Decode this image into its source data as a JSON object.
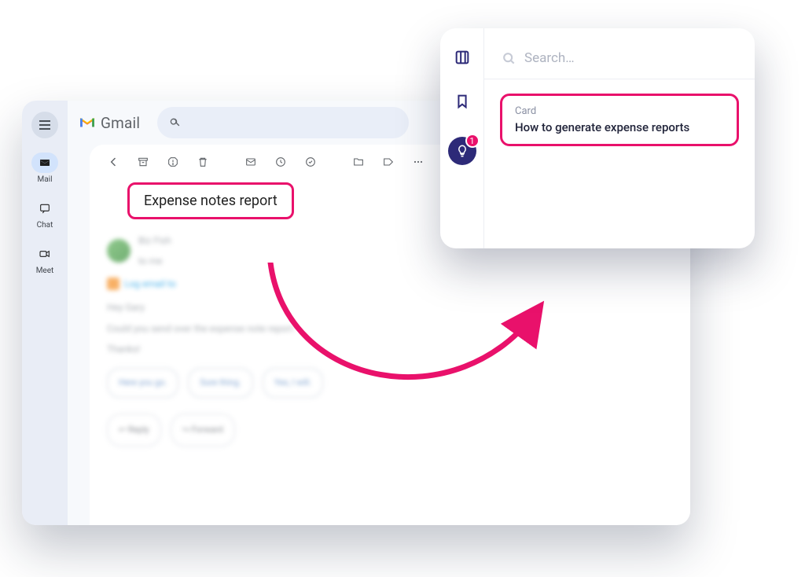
{
  "gmail": {
    "app_name": "Gmail",
    "rail": {
      "mail_label": "Mail",
      "chat_label": "Chat",
      "meet_label": "Meet"
    },
    "toolbar": {
      "back_name": "back-icon",
      "archive_name": "archive-icon",
      "spam_name": "report-spam-icon",
      "delete_name": "delete-icon",
      "unread_name": "mark-unread-icon",
      "snooze_name": "snooze-icon",
      "addtask_name": "add-task-icon",
      "move_name": "move-to-icon",
      "label_name": "labels-icon",
      "more_name": "more-icon"
    },
    "subject": "Expense notes report",
    "blurred": {
      "sender_name": "Biz Fish",
      "to_line": "to me",
      "log_text": "Log email to",
      "body_line1": "Hey Gary",
      "body_line2": "Could you send over the expense note report",
      "body_line3": "Thanks!",
      "smartreply1": "Here you go.",
      "smartreply2": "Sure thing.",
      "smartreply3": "Yes, I will.",
      "reply_label": "Reply",
      "forward_label": "Forward"
    }
  },
  "panel": {
    "search_placeholder": "Search…",
    "idea_count": "1",
    "card": {
      "label": "Card",
      "title": "How to generate expense reports"
    }
  },
  "colors": {
    "highlight": "#e9116b",
    "brand_navy": "#2d2a78"
  }
}
